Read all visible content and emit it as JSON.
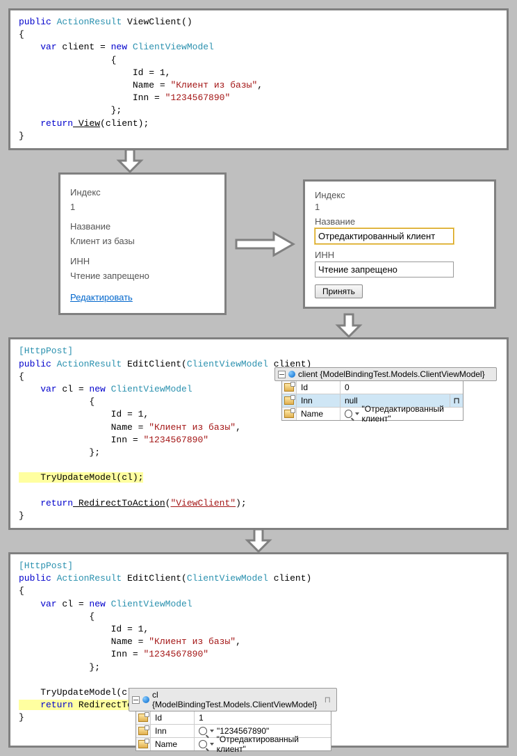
{
  "code1": {
    "l1": {
      "a": "public",
      "b": "ActionResult",
      "c": " ViewClient()"
    },
    "l2": "{",
    "l3": {
      "a": "    var",
      "b": " client = ",
      "c": "new",
      "d": " ClientViewModel"
    },
    "l4": "                 {",
    "l5": "                     Id = 1,",
    "l6a": "                     Name = ",
    "l6b": "\"Клиент из базы\"",
    "l6c": ",",
    "l7a": "                     Inn = ",
    "l7b": "\"1234567890\"",
    "l8": "                 };",
    "l9a": "    return",
    "l9b": " View",
    "l9c": "(client);",
    "l10": "}"
  },
  "view": {
    "index_label": "Индекс",
    "index_val": "1",
    "name_label": "Название",
    "name_val": "Клиент из базы",
    "inn_label": "ИНН",
    "inn_val": "Чтение запрещено",
    "edit_link": "Редактировать"
  },
  "edit": {
    "index_label": "Индекс",
    "index_val": "1",
    "name_label": "Название",
    "name_input": "Отредактированный клиент",
    "inn_label": "ИНН",
    "inn_input": "Чтение запрещено",
    "submit": "Принять"
  },
  "code2": {
    "attr": "[HttpPost]",
    "l1": {
      "a": "public",
      "b": " ActionResult",
      "c": " EditClient(",
      "d": "ClientViewModel",
      "e": " client)"
    },
    "l2": "{",
    "l3": {
      "a": "    var",
      "b": " cl = ",
      "c": "new",
      "d": " ClientViewModel"
    },
    "l4": "             {",
    "l5": "                 Id = 1,",
    "l6a": "                 Name = ",
    "l6b": "\"Клиент из базы\"",
    "l6c": ",",
    "l7a": "                 Inn = ",
    "l7b": "\"1234567890\"",
    "l8": "             };",
    "blank": "",
    "hl": "    TryUpdateModel(cl);",
    "ret_a": "    return",
    "ret_b": " RedirectToAction",
    "ret_c": "(",
    "ret_d": "\"ViewClient\"",
    "ret_e": ");",
    "l10": "}"
  },
  "tooltip1": {
    "header": "client {ModelBindingTest.Models.ClientViewModel}",
    "rows": [
      {
        "name": "Id",
        "val": "0",
        "mag": false
      },
      {
        "name": "Inn",
        "val": "null",
        "mag": false,
        "sel": true
      },
      {
        "name": "Name",
        "val": "\"Отредактированный клиент\"",
        "mag": true
      }
    ]
  },
  "code3": {
    "attr": "[HttpPost]",
    "l1": {
      "a": "public",
      "b": " ActionResult",
      "c": " EditClient(",
      "d": "ClientViewModel",
      "e": " client)"
    },
    "l2": "{",
    "l3": {
      "a": "    var",
      "b": " cl = ",
      "c": "new",
      "d": " ClientViewModel"
    },
    "l4": "             {",
    "l5": "                 Id = 1,",
    "l6a": "                 Name = ",
    "l6b": "\"Клиент из базы\"",
    "l6c": ",",
    "l7a": "                 Inn = ",
    "l7b": "\"1234567890\"",
    "l8": "             };",
    "blank": "",
    "upd": "    TryUpdateModel(cl);",
    "hl_a": "    return",
    "hl_b": " RedirectToAc",
    "l10": "}"
  },
  "tooltip2": {
    "header": "cl {ModelBindingTest.Models.ClientViewModel}",
    "rows": [
      {
        "name": "Id",
        "val": "1",
        "mag": false
      },
      {
        "name": "Inn",
        "val": "\"1234567890\"",
        "mag": true
      },
      {
        "name": "Name",
        "val": "\"Отредактированный клиент\"",
        "mag": true
      }
    ]
  }
}
